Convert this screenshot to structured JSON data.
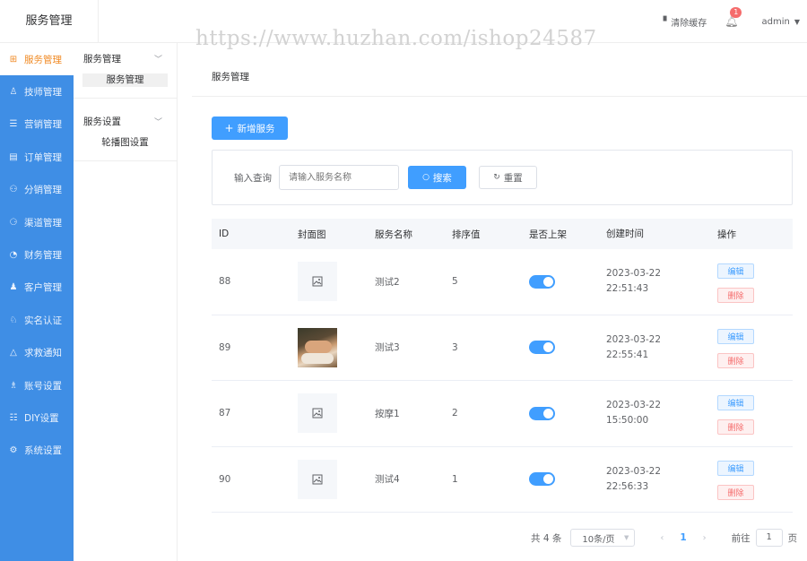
{
  "app": {
    "title": "服务管理"
  },
  "watermark": "https://www.huzhan.com/ishop24587",
  "header": {
    "clear_cache": "清除缓存",
    "notify_count": "1",
    "user": "admin"
  },
  "sidebar": {
    "items": [
      {
        "label": "服务管理",
        "icon": "service-icon",
        "active": true
      },
      {
        "label": "技师管理",
        "icon": "technician-icon"
      },
      {
        "label": "营销管理",
        "icon": "marketing-icon"
      },
      {
        "label": "订单管理",
        "icon": "order-icon"
      },
      {
        "label": "分销管理",
        "icon": "distribution-icon"
      },
      {
        "label": "渠道管理",
        "icon": "channel-icon"
      },
      {
        "label": "财务管理",
        "icon": "finance-icon"
      },
      {
        "label": "客户管理",
        "icon": "customer-icon"
      },
      {
        "label": "实名认证",
        "icon": "verify-icon"
      },
      {
        "label": "求救通知",
        "icon": "alarm-icon"
      },
      {
        "label": "账号设置",
        "icon": "account-icon"
      },
      {
        "label": "DIY设置",
        "icon": "diy-icon"
      },
      {
        "label": "系统设置",
        "icon": "settings-icon"
      }
    ]
  },
  "submenu": {
    "groups": [
      {
        "title": "服务管理",
        "items": [
          "服务管理"
        ]
      },
      {
        "title": "服务设置",
        "items": [
          "轮播图设置"
        ]
      }
    ]
  },
  "main": {
    "page_title": "服务管理",
    "add_button": "新增服务",
    "filter": {
      "label": "输入查询",
      "placeholder": "请输入服务名称",
      "search": "搜索",
      "reset": "重置"
    },
    "table": {
      "headers": [
        "ID",
        "封面图",
        "服务名称",
        "排序值",
        "是否上架",
        "创建时间",
        "操作"
      ],
      "rows": [
        {
          "id": "88",
          "cover": "placeholder",
          "name": "测试2",
          "sort": "5",
          "on_shelf": true,
          "date": "2023-03-22",
          "time": "22:51:43"
        },
        {
          "id": "89",
          "cover": "photo",
          "name": "测试3",
          "sort": "3",
          "on_shelf": true,
          "date": "2023-03-22",
          "time": "22:55:41"
        },
        {
          "id": "87",
          "cover": "placeholder",
          "name": "按摩1",
          "sort": "2",
          "on_shelf": true,
          "date": "2023-03-22",
          "time": "15:50:00"
        },
        {
          "id": "90",
          "cover": "placeholder",
          "name": "测试4",
          "sort": "1",
          "on_shelf": true,
          "date": "2023-03-22",
          "time": "22:56:33"
        }
      ],
      "edit_label": "编辑",
      "delete_label": "删除"
    },
    "pagination": {
      "total": "共 4 条",
      "page_size": "10条/页",
      "current_page": "1",
      "goto_label": "前往",
      "goto_value": "1",
      "page_suffix": "页"
    }
  },
  "colors": {
    "primary": "#409eff",
    "sidebar": "#3f8ee5",
    "active_text": "#f08a24",
    "danger": "#f56c6c"
  }
}
